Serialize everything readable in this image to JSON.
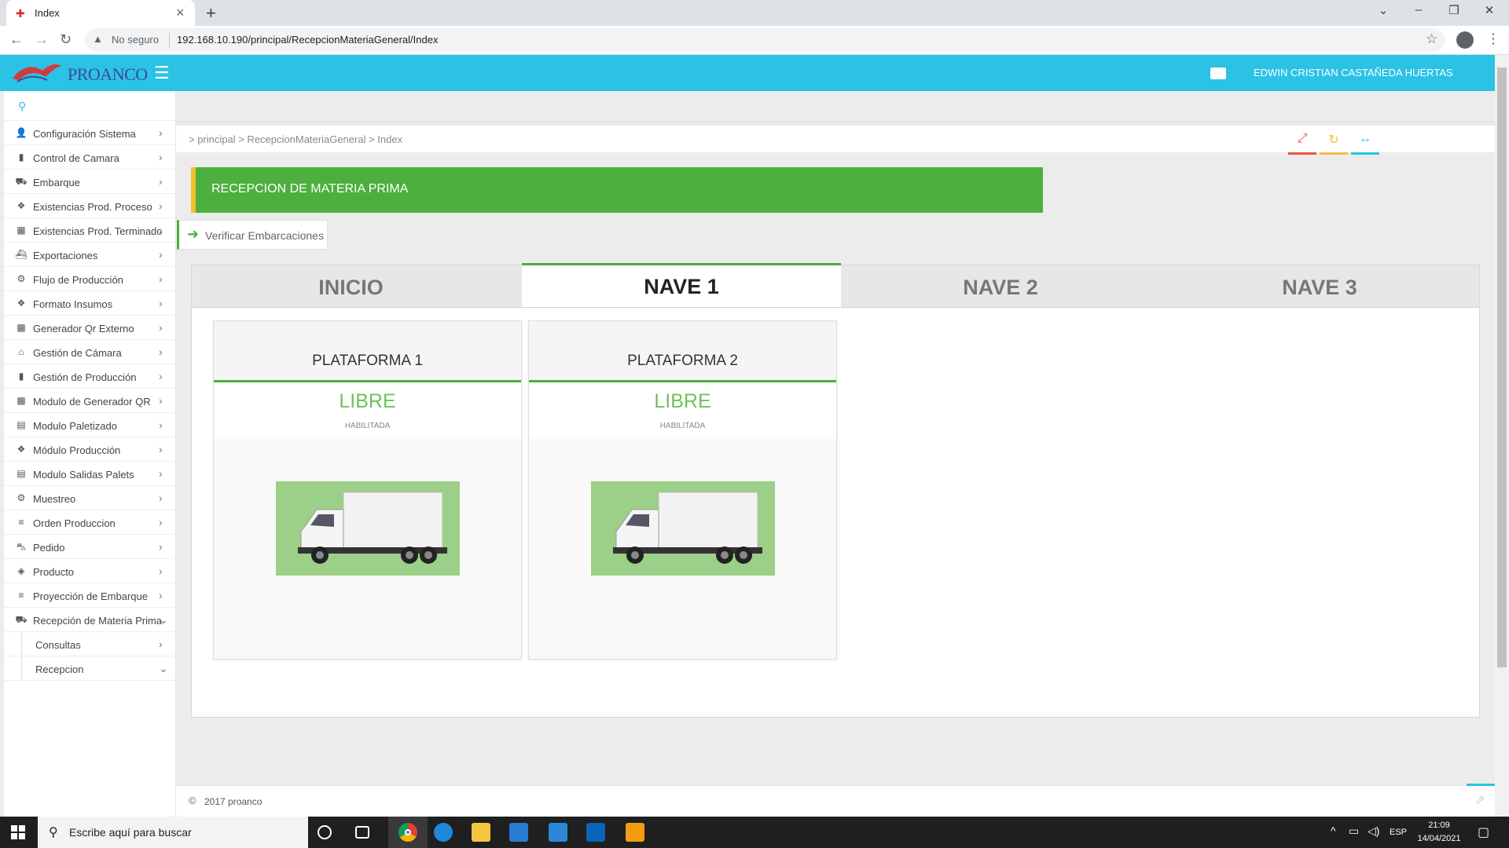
{
  "browser": {
    "tab_title": "Index",
    "security_label": "No seguro",
    "url": "192.168.10.190/principal/RecepcionMateriaGeneral/Index"
  },
  "header": {
    "logo_text": "PROANCO",
    "user_name": "EDWIN CRISTIAN CASTAÑEDA HUERTAS",
    "accent_color": "#2bc2e6"
  },
  "sidebar": {
    "items": [
      {
        "label": "Configuración Sistema",
        "icon": "user-icon"
      },
      {
        "label": "Control de Camara",
        "icon": "bar-chart-icon"
      },
      {
        "label": "Embarque",
        "icon": "truck-icon"
      },
      {
        "label": "Existencias Prod. Proceso",
        "icon": "cubes-icon"
      },
      {
        "label": "Existencias Prod. Terminado",
        "icon": "building-icon"
      },
      {
        "label": "Exportaciones",
        "icon": "ship-icon"
      },
      {
        "label": "Flujo de Producción",
        "icon": "cogs-icon"
      },
      {
        "label": "Formato Insumos",
        "icon": "cubes-icon"
      },
      {
        "label": "Generador Qr Externo",
        "icon": "qrcode-icon"
      },
      {
        "label": "Gestión de Cámara",
        "icon": "bank-icon"
      },
      {
        "label": "Gestión de Producción",
        "icon": "bar-chart-icon"
      },
      {
        "label": "Modulo de Generador QR",
        "icon": "qrcode-icon"
      },
      {
        "label": "Modulo Paletizado",
        "icon": "calendar-icon"
      },
      {
        "label": "Módulo Producción",
        "icon": "cubes-icon"
      },
      {
        "label": "Modulo Salidas Palets",
        "icon": "calendar-icon"
      },
      {
        "label": "Muestreo",
        "icon": "cogs-icon"
      },
      {
        "label": "Orden Produccion",
        "icon": "sliders-icon"
      },
      {
        "label": "Pedido",
        "icon": "cart-icon"
      },
      {
        "label": "Producto",
        "icon": "cube-icon"
      },
      {
        "label": "Proyección de Embarque",
        "icon": "sliders-icon"
      },
      {
        "label": "Recepción de Materia Prima",
        "icon": "truck-icon"
      }
    ],
    "sub_items": [
      {
        "label": "Consultas"
      },
      {
        "label": "Recepcion"
      }
    ]
  },
  "breadcrumb": "> principal > RecepcionMateriaGeneral > Index",
  "page": {
    "banner_title": "RECEPCION DE MATERIA PRIMA",
    "verify_button": "Verificar Embarcaciones"
  },
  "tabs": [
    {
      "label": "INICIO",
      "active": false
    },
    {
      "label": "NAVE 1",
      "active": true
    },
    {
      "label": "NAVE 2",
      "active": false
    },
    {
      "label": "NAVE 3",
      "active": false
    }
  ],
  "platforms": [
    {
      "title": "PLATAFORMA 1",
      "status": "LIBRE",
      "substatus": "HABILITADA"
    },
    {
      "title": "PLATAFORMA 2",
      "status": "LIBRE",
      "substatus": "HABILITADA"
    }
  ],
  "footer": {
    "copyright": "2017 proanco"
  },
  "taskbar": {
    "search_placeholder": "Escribe aquí para buscar",
    "language": "ESP",
    "time": "21:09",
    "date": "14/04/2021"
  },
  "colors": {
    "banner_green": "#4caf3e",
    "banner_accent": "#f2c12e",
    "status_green": "#6cc35a",
    "tool_red": "#e9573f",
    "tool_yellow": "#f6bb42",
    "tool_blue": "#2bc2e6"
  }
}
